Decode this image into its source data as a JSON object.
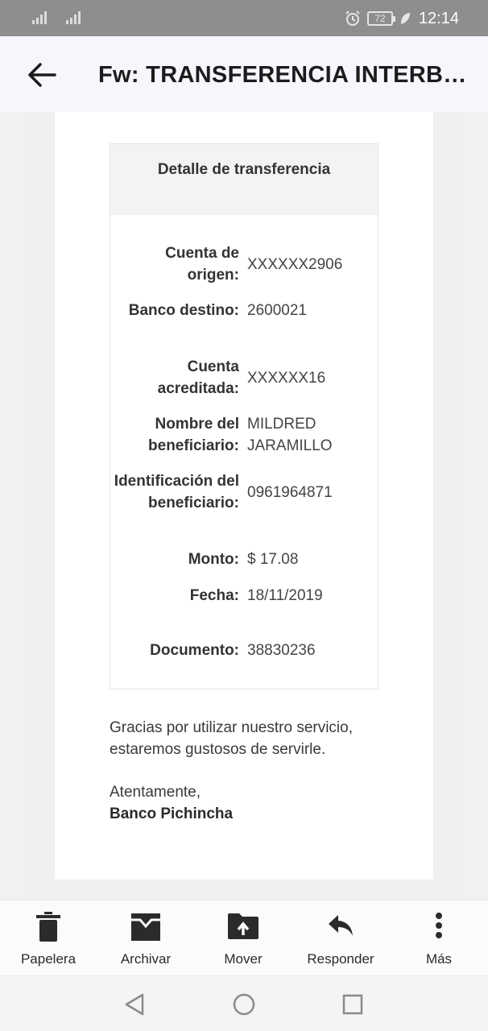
{
  "status_bar": {
    "battery_level": "72",
    "time": "12:14"
  },
  "header": {
    "title": "Fw: TRANSFERENCIA INTERBA..."
  },
  "detail": {
    "header": "Detalle de transferencia",
    "rows": [
      {
        "label": "Cuenta de origen:",
        "value": "XXXXXX2906"
      },
      {
        "label": "Banco destino:",
        "value": "2600021"
      },
      {
        "label": "Cuenta acreditada:",
        "value": "XXXXXX16"
      },
      {
        "label": "Nombre del beneficiario:",
        "value": "MILDRED JARAMILLO"
      },
      {
        "label": "Identificación del beneficiario:",
        "value": "0961964871"
      },
      {
        "label": "Monto:",
        "value": "$ 17.08"
      },
      {
        "label": "Fecha:",
        "value": "18/11/2019"
      },
      {
        "label": "Documento:",
        "value": "38830236"
      }
    ]
  },
  "body": {
    "closing": "Gracias por utilizar nuestro servicio, estaremos gustosos de servirle.",
    "regards": "Atentamente,",
    "signature": "Banco Pichincha"
  },
  "toolbar": {
    "trash_label": "Papelera",
    "archive_label": "Archivar",
    "move_label": "Mover",
    "reply_label": "Responder",
    "more_label": "Más"
  },
  "colors": {
    "status_bar": "#8e8e8e",
    "app_bar": "#f7f6fd",
    "icon": "#2b2b2b"
  }
}
